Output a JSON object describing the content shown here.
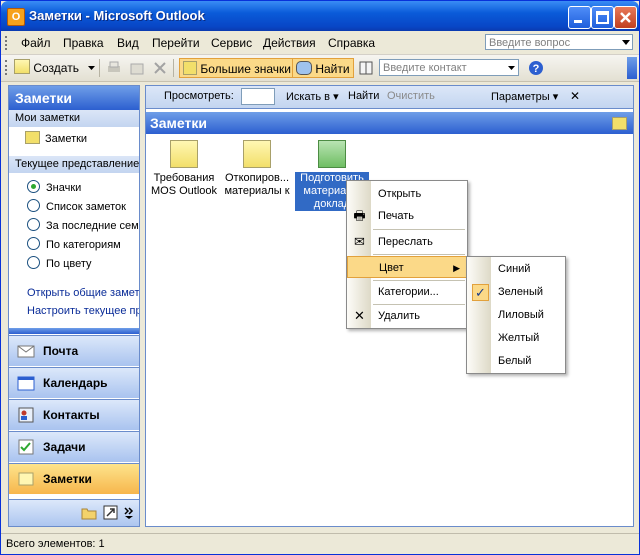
{
  "window": {
    "title": "Заметки - Microsoft Outlook",
    "app_icon": "O"
  },
  "menu": [
    "Файл",
    "Правка",
    "Вид",
    "Перейти",
    "Сервис",
    "Действия",
    "Справка"
  ],
  "ask_placeholder": "Введите вопрос",
  "toolbar": {
    "create": "Создать",
    "large_icons": "Большие значки",
    "find": "Найти",
    "contact_placeholder": "Введите контакт"
  },
  "nav": {
    "header": "Заметки",
    "my_notes_section": "Мои заметки",
    "my_notes_item": "Заметки",
    "current_view_section": "Текущее представление",
    "views": [
      {
        "label": "Значки",
        "selected": true
      },
      {
        "label": "Список заметок",
        "selected": false
      },
      {
        "label": "За последние семь дней",
        "selected": false
      },
      {
        "label": "По категориям",
        "selected": false
      },
      {
        "label": "По цвету",
        "selected": false
      }
    ],
    "links": [
      "Открыть общие заметки...",
      "Настроить текущее представление..."
    ],
    "buttons": [
      "Почта",
      "Календарь",
      "Контакты",
      "Задачи",
      "Заметки"
    ]
  },
  "viewbar": {
    "view_label": "Просмотреть:",
    "search_in": "Искать в",
    "find": "Найти",
    "clear": "Очистить",
    "options": "Параметры",
    "close": "✕"
  },
  "main": {
    "header": "Заметки",
    "notes": [
      {
        "line1": "Требования",
        "line2": "MOS Outlook",
        "color": "#f2df6a"
      },
      {
        "line1": "Откопиров...",
        "line2": "материалы к",
        "color": "#f2df6a"
      },
      {
        "line1": "Подготовить",
        "line2": "материалы",
        "line3": "доклад",
        "color": "#6fbe63"
      }
    ]
  },
  "context_menu": {
    "items": [
      "Открыть",
      "Печать",
      "Переслать",
      "Цвет",
      "Категории...",
      "Удалить"
    ]
  },
  "color_submenu": {
    "items": [
      "Синий",
      "Зеленый",
      "Лиловый",
      "Желтый",
      "Белый"
    ],
    "checked": "Зеленый"
  },
  "status": "Всего элементов: 1"
}
